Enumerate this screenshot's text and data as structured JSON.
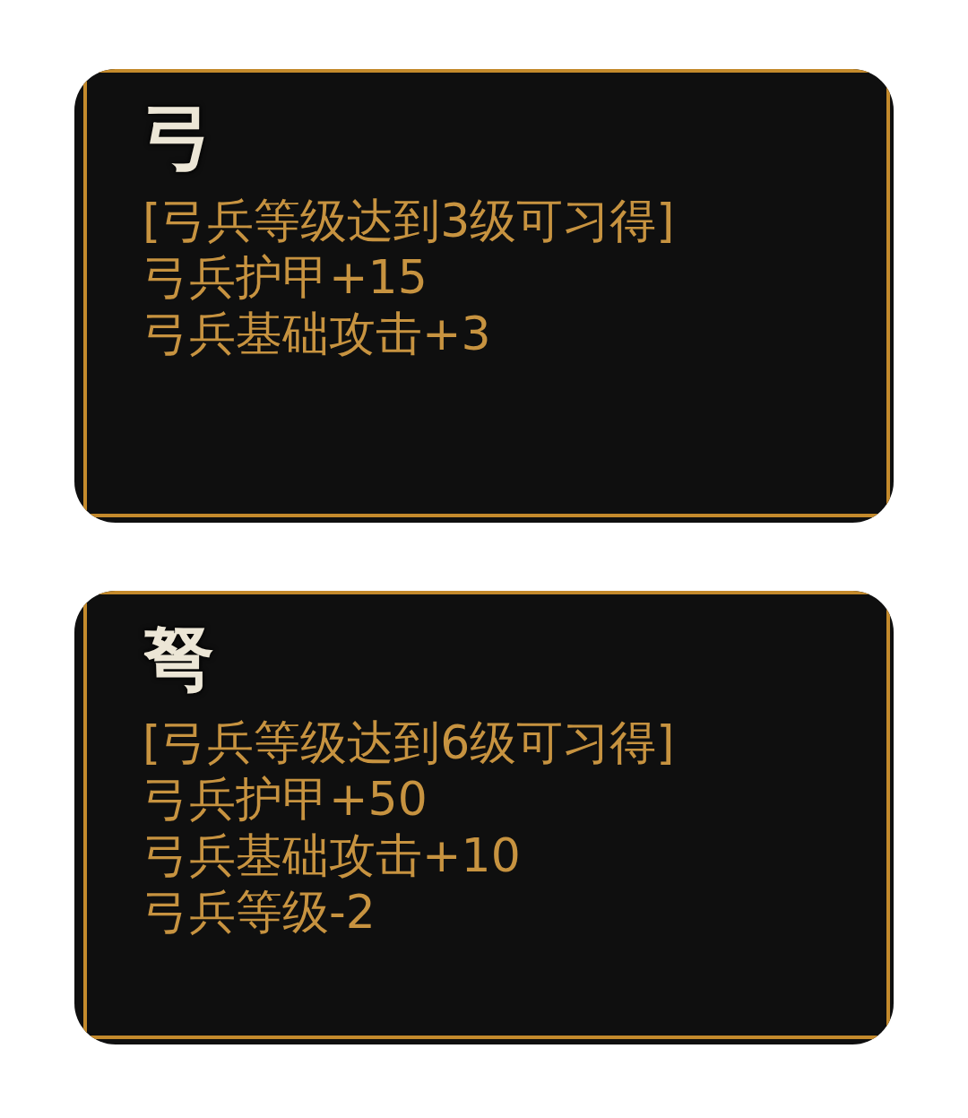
{
  "cards": [
    {
      "title": "弓",
      "lines": [
        "[弓兵等级达到3级可习得]",
        "弓兵护甲+15",
        "弓兵基础攻击+3"
      ]
    },
    {
      "title": "弩",
      "lines": [
        "[弓兵等级达到6级可习得]",
        "弓兵护甲+50",
        "弓兵基础攻击+10",
        "弓兵等级-2"
      ]
    }
  ]
}
